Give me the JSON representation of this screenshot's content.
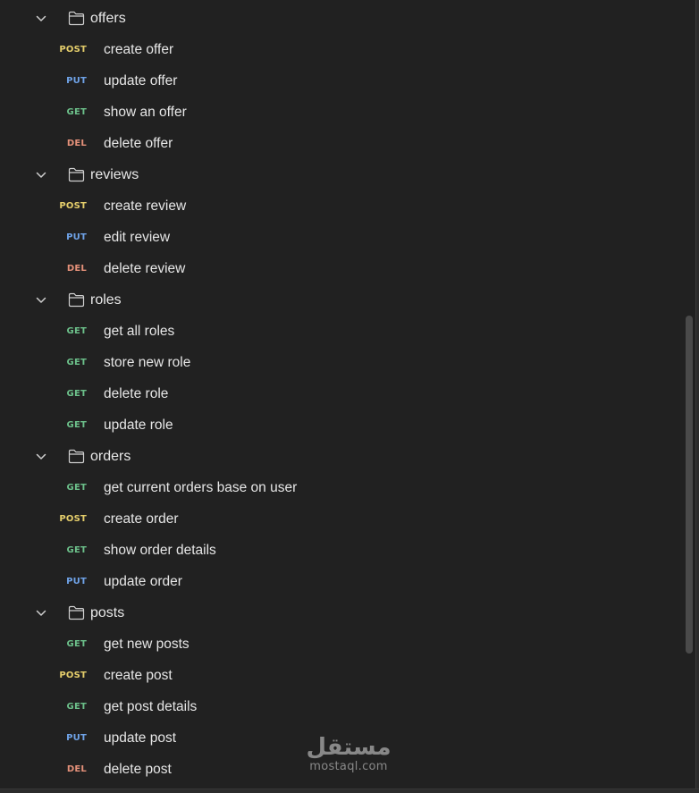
{
  "collection": {
    "folders": [
      {
        "name": "offers",
        "requests": [
          {
            "method": "POST",
            "name": "create offer"
          },
          {
            "method": "PUT",
            "name": "update offer"
          },
          {
            "method": "GET",
            "name": "show an offer"
          },
          {
            "method": "DEL",
            "name": "delete offer"
          }
        ]
      },
      {
        "name": "reviews",
        "requests": [
          {
            "method": "POST",
            "name": "create review"
          },
          {
            "method": "PUT",
            "name": "edit review"
          },
          {
            "method": "DEL",
            "name": "delete review"
          }
        ]
      },
      {
        "name": "roles",
        "requests": [
          {
            "method": "GET",
            "name": "get all roles"
          },
          {
            "method": "GET",
            "name": "store new role"
          },
          {
            "method": "GET",
            "name": "delete role"
          },
          {
            "method": "GET",
            "name": "update role"
          }
        ]
      },
      {
        "name": "orders",
        "requests": [
          {
            "method": "GET",
            "name": "get current orders base on user"
          },
          {
            "method": "POST",
            "name": "create order"
          },
          {
            "method": "GET",
            "name": "show order details"
          },
          {
            "method": "PUT",
            "name": "update order"
          }
        ]
      },
      {
        "name": "posts",
        "requests": [
          {
            "method": "GET",
            "name": "get new posts"
          },
          {
            "method": "POST",
            "name": "create post"
          },
          {
            "method": "GET",
            "name": "get post details"
          },
          {
            "method": "PUT",
            "name": "update post"
          },
          {
            "method": "DEL",
            "name": "delete post"
          }
        ]
      }
    ]
  },
  "method_colors": {
    "POST": "#e4cd6b",
    "PUT": "#6fa3e8",
    "GET": "#6cc08a",
    "DEL": "#e5917a"
  },
  "icons": {
    "toggle": "chevron-down-icon",
    "folder": "folder-icon"
  },
  "watermark": {
    "arabic": "مستقل",
    "latin": "mostaql.com"
  }
}
